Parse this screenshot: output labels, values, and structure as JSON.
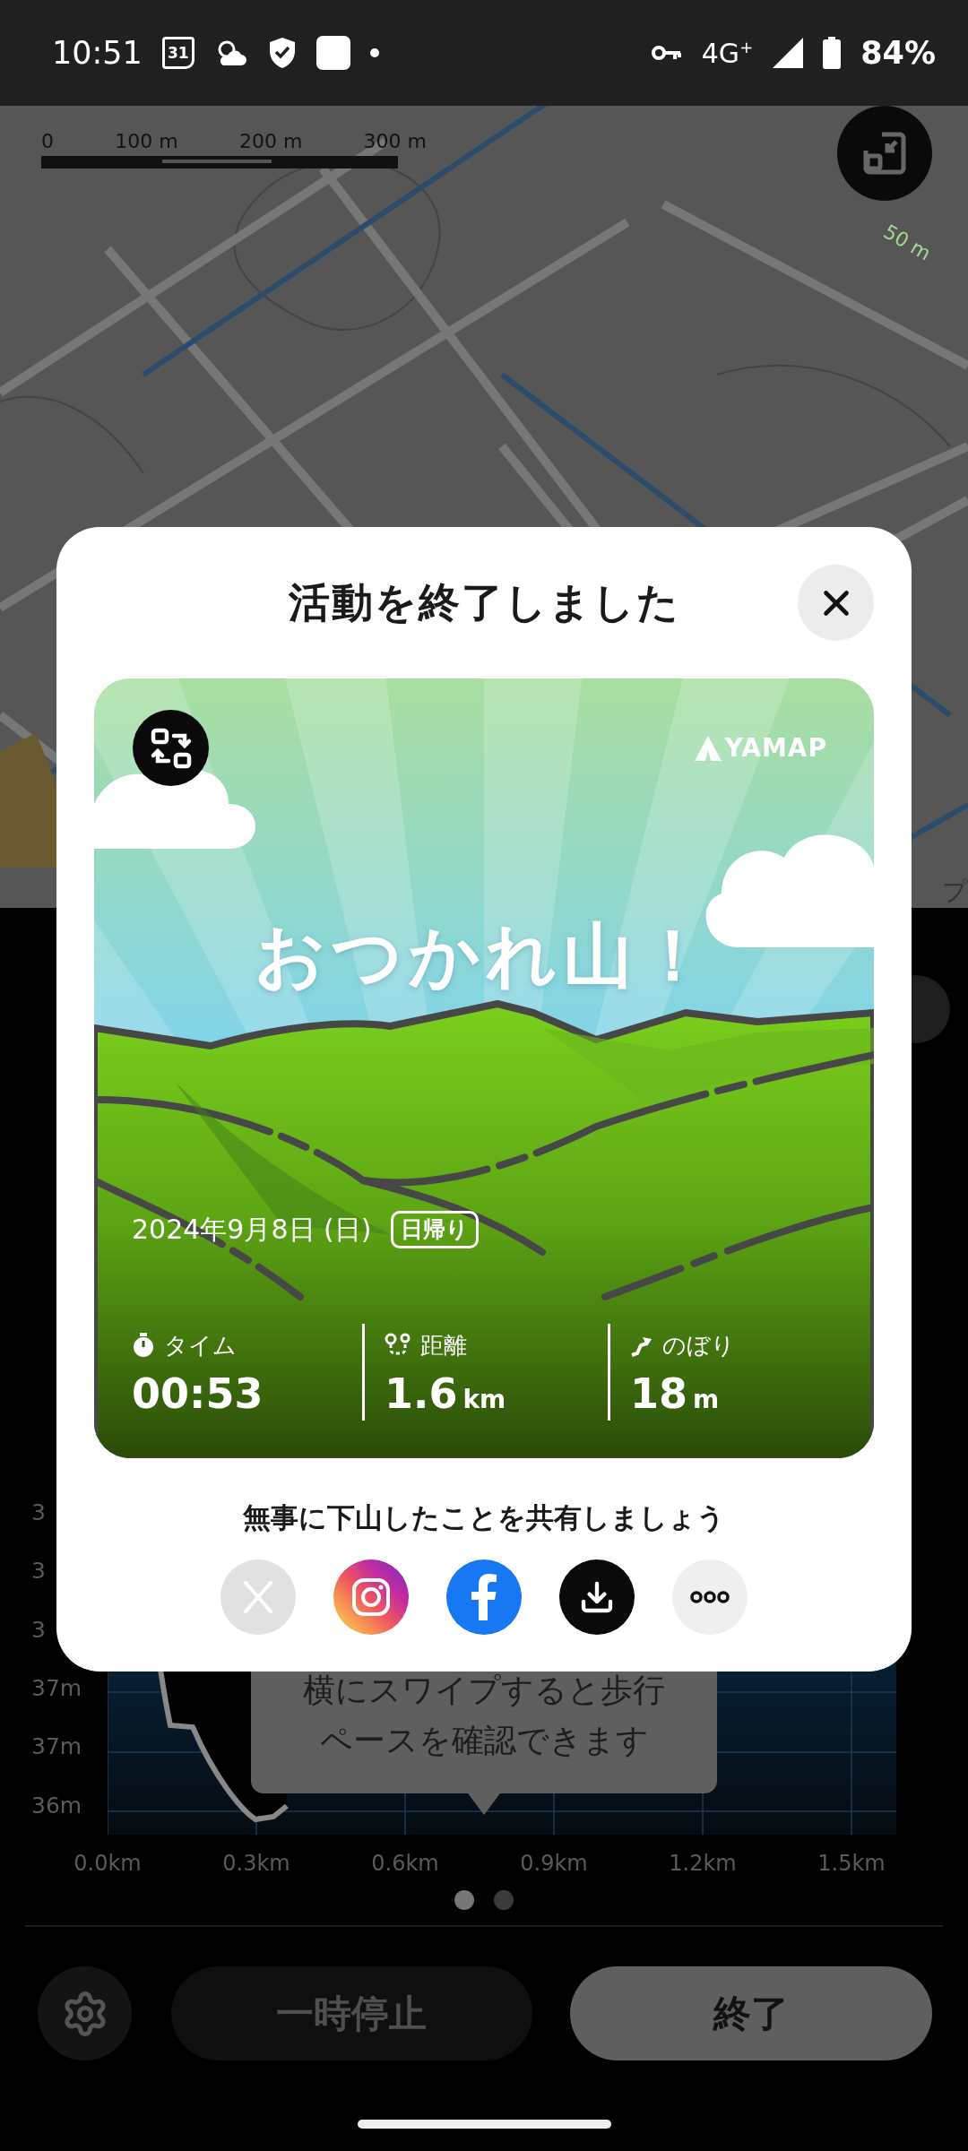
{
  "status_bar": {
    "time": "10:51",
    "calendar_day": "31",
    "network": "4G$^{+}$",
    "battery": "84%"
  },
  "map": {
    "scale_labels": [
      "0",
      "100 m",
      "200 m",
      "300 m"
    ],
    "contour_label": "50 m",
    "place_label": "プ"
  },
  "activity_panel": {
    "chart": {
      "y_labels": [
        "3",
        "3",
        "3",
        "37m",
        "37m",
        "36m"
      ],
      "x_labels": [
        "0.0km",
        "0.3km",
        "0.6km",
        "0.9km",
        "1.2km",
        "1.5km"
      ],
      "tooltip": "横にスワイプすると歩行ペースを確認できます"
    },
    "pages": [
      {
        "selected": true
      },
      {
        "selected": false
      }
    ],
    "pause_button": "一時停止",
    "end_button": "終了"
  },
  "modal": {
    "title": "活動を終了しました",
    "card": {
      "logo": "YAMAP",
      "headline": "おつかれ山！",
      "date": "2024年9月8日 (日)",
      "tag": "日帰り",
      "stats": [
        {
          "kind": "time",
          "label": "タイム",
          "value": "00:53"
        },
        {
          "kind": "distance",
          "label": "距離",
          "value": "1.6",
          "unit": "km"
        },
        {
          "kind": "climb",
          "label": "のぼり",
          "value": "18",
          "unit": "m"
        }
      ]
    },
    "share_prompt": "無事に下山したことを共有しましょう",
    "share_buttons": [
      {
        "kind": "x",
        "disabled": true
      },
      {
        "kind": "instagram",
        "disabled": false
      },
      {
        "kind": "facebook",
        "disabled": false
      },
      {
        "kind": "download",
        "disabled": false
      },
      {
        "kind": "more",
        "disabled": false
      }
    ]
  }
}
